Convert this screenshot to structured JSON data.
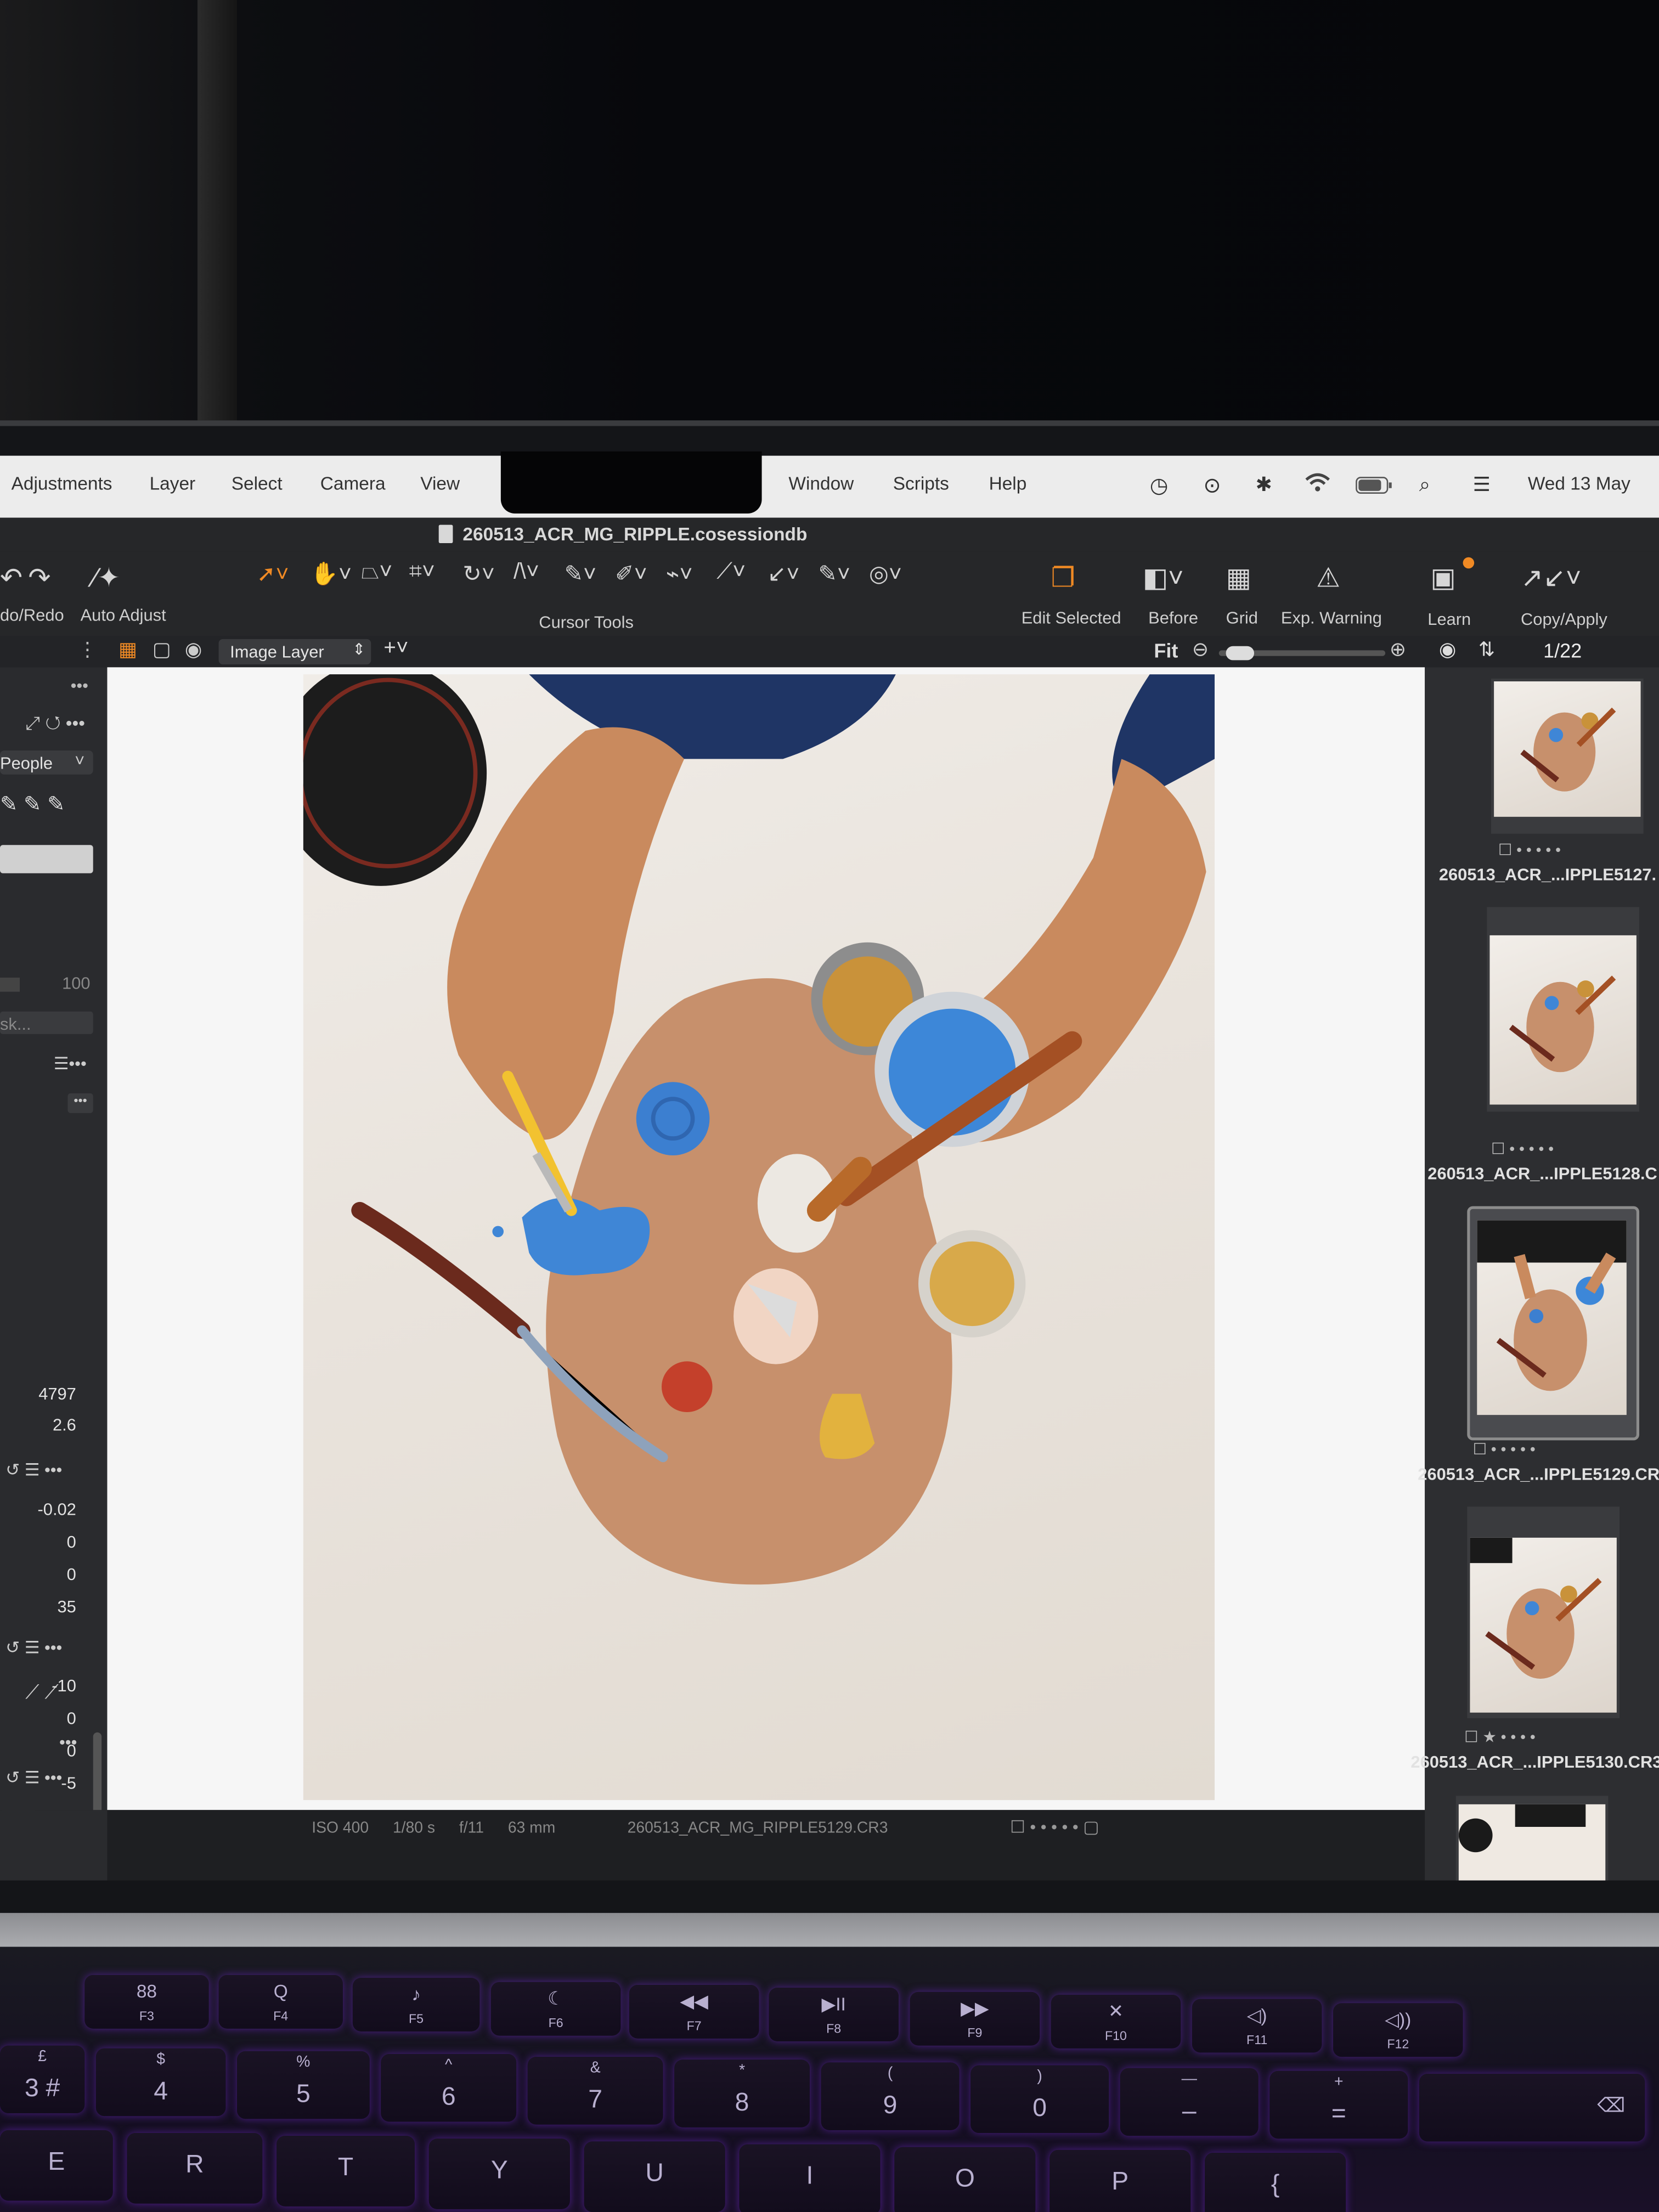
{
  "menubar": {
    "items": [
      "Adjustments",
      "Layer",
      "Select",
      "Camera",
      "View",
      "Window",
      "Scripts",
      "Help"
    ],
    "clock": "Wed 13 May"
  },
  "titlebar": {
    "title": "260513_ACR_MG_RIPPLE.cosessiondb"
  },
  "toolbar": {
    "undo_redo_label": "do/Redo",
    "auto_adjust_label": "Auto Adjust",
    "cursor_tools_label": "Cursor Tools",
    "edit_selected_label": "Edit Selected",
    "before_label": "Before",
    "grid_label": "Grid",
    "exp_warning_label": "Exp. Warning",
    "learn_label": "Learn",
    "copy_apply_label": "Copy/Apply"
  },
  "viewer": {
    "layer_select": "Image Layer",
    "zoom_label": "Fit",
    "zoom_level": 0.05,
    "info": {
      "iso": "ISO 400",
      "shutter": "1/80 s",
      "aperture": "f/11",
      "focal": "63 mm",
      "filename": "260513_ACR_MG_RIPPLE5129.CR3"
    }
  },
  "left_panel": {
    "people_select": "People",
    "opacity_value": "100",
    "mask_field": "sk...",
    "wb_kelvin": "4797",
    "wb_tint": "2.6",
    "exposure_values": [
      "-0.02",
      "0",
      "0",
      "35"
    ],
    "hdr_values": [
      "-10",
      "0",
      "0",
      "-5"
    ]
  },
  "browser": {
    "counter": "1/22",
    "thumbnails": [
      {
        "name": "260513_ACR_...IPPLE5127.",
        "stars": 0
      },
      {
        "name": "260513_ACR_...IPPLE5128.C",
        "stars": 0
      },
      {
        "name": "260513_ACR_...IPPLE5129.CR",
        "stars": 0,
        "selected": true
      },
      {
        "name": "260513_ACR_...IPPLE5130.CR3",
        "stars": 1
      }
    ]
  },
  "keyboard": {
    "fn_row": [
      {
        "glyph": "88",
        "label": "F3"
      },
      {
        "glyph": "Q",
        "label": "F4"
      },
      {
        "glyph": "♪",
        "label": "F5"
      },
      {
        "glyph": "☾",
        "label": "F6"
      },
      {
        "glyph": "◀◀",
        "label": "F7"
      },
      {
        "glyph": "▶II",
        "label": "F8"
      },
      {
        "glyph": "▶▶",
        "label": "F9"
      },
      {
        "glyph": "✕",
        "label": "F10"
      },
      {
        "glyph": "◁)",
        "label": "F11"
      },
      {
        "glyph": "◁))",
        "label": "F12"
      }
    ],
    "num_row": [
      {
        "top": "£",
        "main": "3 #"
      },
      {
        "top": "$",
        "main": "4"
      },
      {
        "top": "%",
        "main": "5"
      },
      {
        "top": "^",
        "main": "6"
      },
      {
        "top": "&",
        "main": "7"
      },
      {
        "top": "*",
        "main": "8"
      },
      {
        "top": "(",
        "main": "9"
      },
      {
        "top": ")",
        "main": "0"
      },
      {
        "top": "—",
        "main": "–"
      },
      {
        "top": "+",
        "main": "="
      }
    ],
    "letter_row": [
      "E",
      "R",
      "T",
      "Y",
      "U",
      "I",
      "O",
      "P",
      "{"
    ]
  },
  "colors": {
    "accent_orange": "#f08a24",
    "blue_paint": "#3f86d6",
    "panel_bg": "#2a2b2e"
  }
}
